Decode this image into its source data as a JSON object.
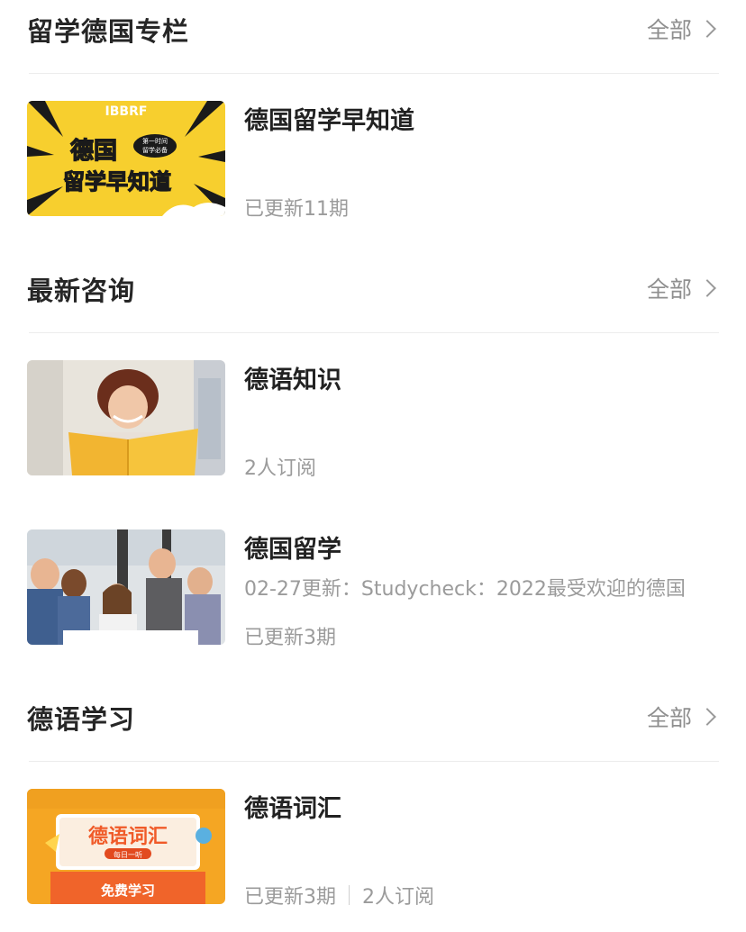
{
  "sections": [
    {
      "title": "留学德国专栏",
      "more": "全部",
      "items": [
        {
          "title": "德国留学早知道",
          "meta": "已更新11期",
          "thumb_text": [
            "IBBRF",
            "德国",
            "留学早知道",
            "第一时间",
            "留学必备"
          ]
        }
      ]
    },
    {
      "title": "最新咨询",
      "more": "全部",
      "items": [
        {
          "title": "德语知识",
          "meta": "2人订阅"
        },
        {
          "title": "德国留学",
          "subtitle": "02-27更新：Studycheck：2022最受欢迎的德国",
          "meta": "已更新3期"
        }
      ]
    },
    {
      "title": "德语学习",
      "more": "全部",
      "items": [
        {
          "title": "德语词汇",
          "meta": "已更新3期",
          "meta2": "2人订阅",
          "thumb_text": [
            "德语词汇",
            "每日一听",
            "免费学习"
          ]
        }
      ]
    }
  ],
  "colors": {
    "accent_yellow": "#f7cf2e",
    "muted_text": "#9b9b9b",
    "divider": "#ececec"
  }
}
